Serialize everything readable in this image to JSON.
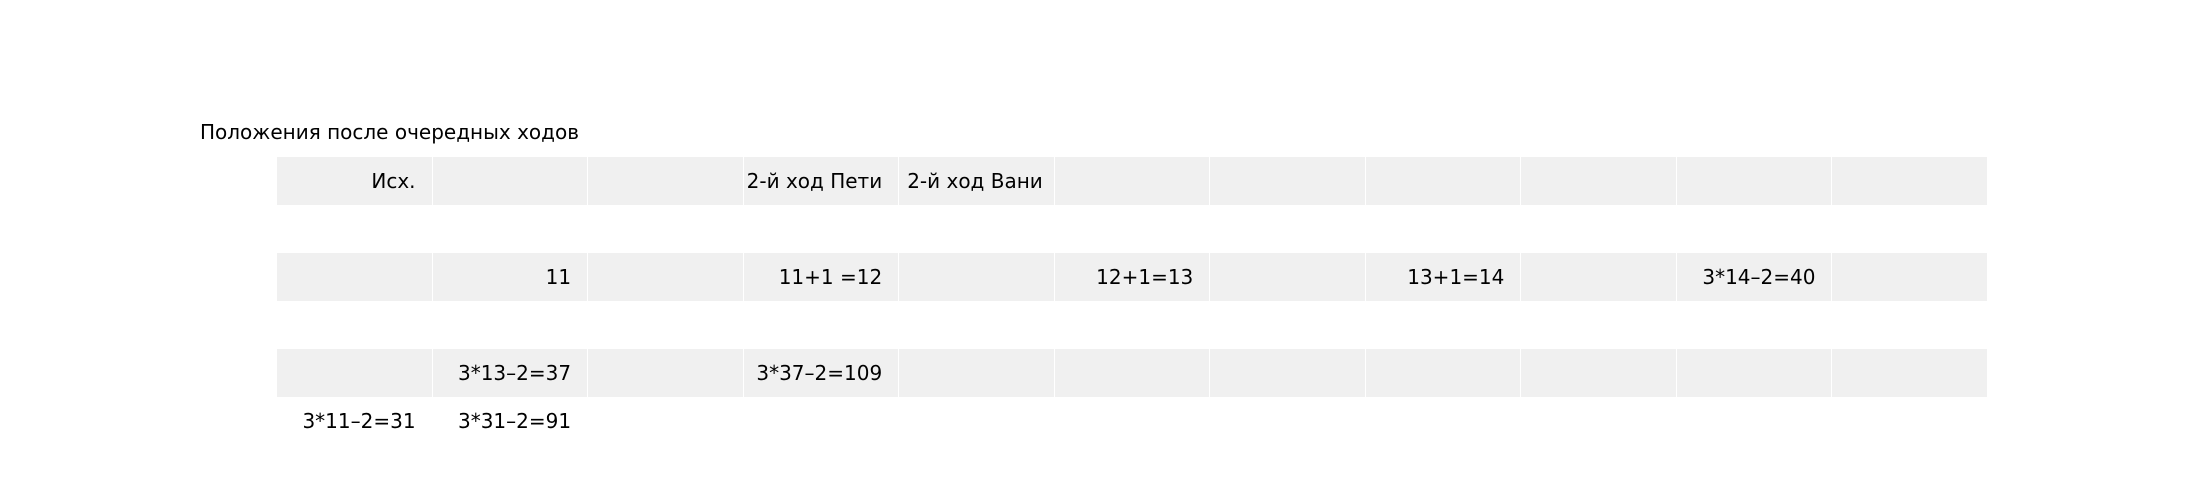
{
  "caption": "Положения после очередных ходов",
  "rows": [
    {
      "shaded": true,
      "cells": [
        "Исх.",
        "",
        "",
        "2-й ход Пети",
        "2-й ход Вани",
        "",
        "",
        "",
        "",
        "",
        ""
      ]
    },
    {
      "shaded": false,
      "cells": [
        "",
        "",
        "",
        "",
        "",
        "",
        "",
        "",
        "",
        "",
        ""
      ]
    },
    {
      "shaded": true,
      "cells": [
        "",
        "11",
        "",
        "11+1 =12",
        "",
        "12+1=13",
        "",
        "13+1=14",
        "",
        "3*14–2=40",
        ""
      ]
    },
    {
      "shaded": false,
      "cells": [
        "",
        "",
        "",
        "",
        "",
        "",
        "",
        "",
        "",
        "",
        ""
      ]
    },
    {
      "shaded": true,
      "cells": [
        "",
        "3*13–2=37",
        "",
        "3*37–2=109",
        "",
        "",
        "",
        "",
        "",
        "",
        ""
      ]
    },
    {
      "shaded": false,
      "cells": [
        "3*11–2=31",
        "3*31–2=91",
        "",
        "",
        "",
        "",
        "",
        "",
        "",
        "",
        ""
      ]
    }
  ]
}
